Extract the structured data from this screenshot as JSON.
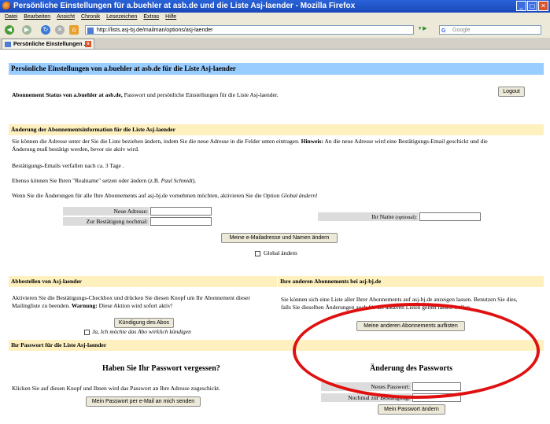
{
  "window": {
    "title": "Persönliche Einstellungen für a.buehler at asb.de und die Liste Asj-laender - Mozilla Firefox",
    "controls": [
      "_",
      "▢",
      "✕"
    ]
  },
  "menu": [
    "Datei",
    "Bearbeiten",
    "Ansicht",
    "Chronik",
    "Lesezeichen",
    "Extras",
    "Hilfe"
  ],
  "nav": {
    "url": "http://lists.asj-bj.de/mailman/options/asj-laender",
    "search_placeholder": "Google",
    "search_engine": "G"
  },
  "tab": {
    "label": "Persönliche Einstellungen ..."
  },
  "page": {
    "title": "Persönliche Einstellungen von a.buehler at asb.de für die Liste Asj-laender",
    "status_bold": "Abonnement Status von a.buehler at asb.de,",
    "status_rest": " Passwort und persönliche Einstellungen für die Liste Asj-laender.",
    "logout": "Logout",
    "change": {
      "header": "Änderung der Abonnementsinformation für die Liste Asj-laender",
      "p1a": "Sie können die Adresse unter der Sie die Liste beziehen ändern, indem Sie die neue Adresse in die Felder unten eintragen. ",
      "p1_hint": "Hinweis:",
      "p1b": " An die neue Adresse wird eine Bestätigungs-Email geschickt und die",
      "p1c": "Änderung muß bestätigt werden, bevor sie aktiv wird.",
      "p2": "Bestätigungs-Emails verfallen nach ca. 3 Tage .",
      "p3a": "Ebenso können Sie Ihren \"Realname\" setzen oder ändern (z.B. ",
      "p3_italic": "Paul Schmidt",
      "p3b": ").",
      "p4a": "Wenn Sie die Änderungen für alle Ihre Abonnements auf asj-bj.de vornehmen möchten, aktivieren Sie die Option ",
      "p4_italic": "Global ändern",
      "p4b": "!",
      "new_address": "Neue Adresse:",
      "confirm_again": "Zur Bestätigung nochmal:",
      "your_name": "Ihr Name",
      "optional": "(optional):",
      "submit": "Meine e-Mailadresse und Namen ändern",
      "global": "Global ändern"
    },
    "unsub": {
      "header": "Abbestellen von Asj-laender",
      "p1": "Aktivieren Sie die Bestätigungs-Checkbox und drücken Sie diesen Knopf um Ihr Abonnement dieser",
      "p2a": "Mailingliste zu beenden. ",
      "warning": "Warnung:",
      "p2b": " Diese Aktion wird sofort aktiv!",
      "button": "Kündigung des Abos",
      "confirm": "Ja, Ich möchte das Abo wirklich kündigen"
    },
    "others": {
      "header": "Ihre anderen Abonnements bei asj-bj.de",
      "p1": "Sie können sich eine Liste aller Ihrer Abonnements auf asj-bj.de anzeigen lassen. Benutzen Sie dies,",
      "p2": "falls Sie dieselben Änderungen auch für die anderen Listen gelten lassen wollen.",
      "button": "Meine anderen Abonnements auflisten"
    },
    "password": {
      "header": "Ihr Passwort für die Liste Asj-laender",
      "forgot_title": "Haben Sie Ihr Passwort vergessen?",
      "forgot_text": "Klicken Sie auf diesen Knopf und Ihnen wird das Passwort an Ihre Adresse zugeschickt.",
      "forgot_button": "Mein Passwort per e-Mail an mich senden",
      "change_title": "Änderung des Passworts",
      "new_pw": "Neues Passwort:",
      "confirm_pw": "Nochmal zur Bestätigung:",
      "change_button": "Mein Passwort ändern"
    }
  }
}
